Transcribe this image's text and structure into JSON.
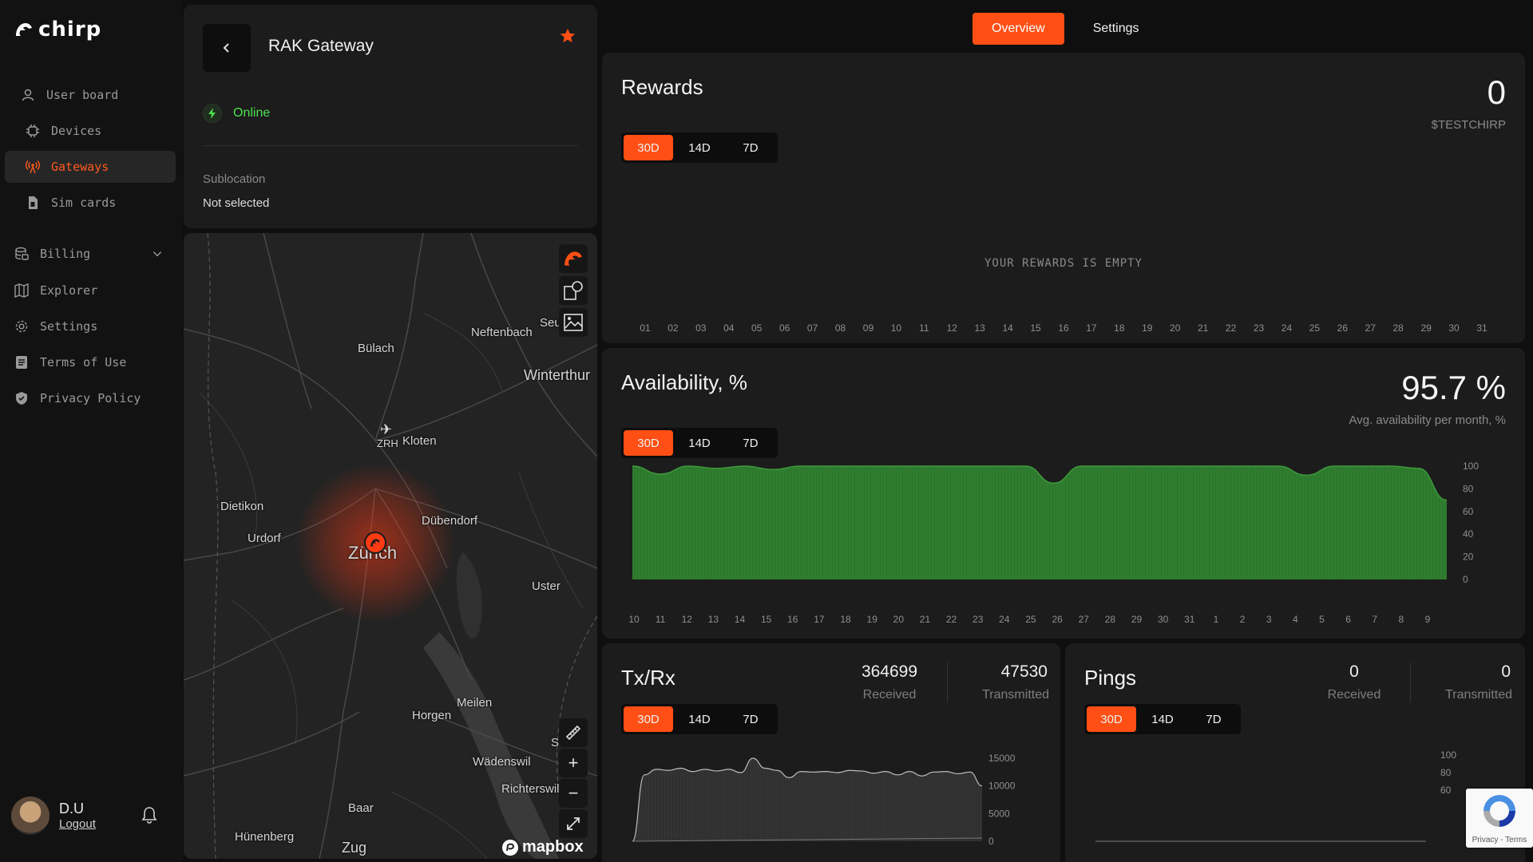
{
  "app": {
    "logo_text": "chirp"
  },
  "sidebar": {
    "items": [
      {
        "label": "User board",
        "icon": "user-icon",
        "active": false
      },
      {
        "label": "Devices",
        "icon": "chip-icon",
        "active": false
      },
      {
        "label": "Gateways",
        "icon": "antenna-icon",
        "active": true
      },
      {
        "label": "Sim cards",
        "icon": "simcard-icon",
        "active": false
      },
      {
        "label": "Billing",
        "icon": "billing-icon",
        "active": false
      },
      {
        "label": "Explorer",
        "icon": "map-icon",
        "active": false
      },
      {
        "label": "Settings",
        "icon": "gear-icon",
        "active": false
      },
      {
        "label": "Terms of Use",
        "icon": "document-icon",
        "active": false
      },
      {
        "label": "Privacy Policy",
        "icon": "shield-icon",
        "active": false
      }
    ],
    "user": {
      "name": "D.U",
      "logout_label": "Logout"
    }
  },
  "gateway": {
    "name": "RAK Gateway",
    "status": "Online",
    "sublocation_label": "Sublocation",
    "sublocation_value": "Not selected"
  },
  "map": {
    "labels": [
      "Neftenbach",
      "Bülach",
      "Winterthur",
      "ZRH",
      "Kloten",
      "Dietikon",
      "Urdorf",
      "Zürich",
      "Dübendorf",
      "Uster",
      "Meilen",
      "Horgen",
      "Wädenswil",
      "Richterswil",
      "Baar",
      "Hünenberg",
      "Zug",
      "Seu",
      "S..."
    ],
    "attribution": "mapbox"
  },
  "tabs": [
    {
      "label": "Overview",
      "active": true
    },
    {
      "label": "Settings",
      "active": false
    }
  ],
  "ranges": [
    "30D",
    "14D",
    "7D"
  ],
  "colors": {
    "accent": "#ff4f14",
    "online": "#4ee14e",
    "availability_fill": "#2f7d2f"
  },
  "rewards": {
    "title": "Rewards",
    "value": "0",
    "unit": "$TESTCHIRP",
    "empty_message": "YOUR REWARDS IS EMPTY",
    "x_ticks": [
      "01",
      "02",
      "03",
      "04",
      "05",
      "06",
      "07",
      "08",
      "09",
      "10",
      "11",
      "12",
      "13",
      "14",
      "15",
      "16",
      "17",
      "18",
      "19",
      "20",
      "21",
      "22",
      "23",
      "24",
      "25",
      "26",
      "27",
      "28",
      "29",
      "30",
      "31"
    ]
  },
  "availability": {
    "title": "Availability, %",
    "value": "95.7 %",
    "subtitle": "Avg. availability per month, %"
  },
  "txrx": {
    "title": "Tx/Rx",
    "received_value": "364699",
    "received_label": "Received",
    "transmitted_value": "47530",
    "transmitted_label": "Transmitted"
  },
  "pings": {
    "title": "Pings",
    "received_value": "0",
    "received_label": "Received",
    "transmitted_value": "0",
    "transmitted_label": "Transmitted"
  },
  "recaptcha": {
    "links": "Privacy - Terms"
  },
  "chart_data": [
    {
      "type": "area",
      "x": [
        "10",
        "11",
        "12",
        "13",
        "14",
        "15",
        "16",
        "17",
        "18",
        "19",
        "20",
        "21",
        "22",
        "23",
        "24",
        "25",
        "26",
        "27",
        "28",
        "29",
        "30",
        "31",
        "1",
        "2",
        "3",
        "4",
        "5",
        "6",
        "7",
        "8",
        "9"
      ],
      "values": [
        100,
        93,
        100,
        98,
        100,
        97,
        100,
        100,
        100,
        100,
        100,
        100,
        100,
        100,
        100,
        85,
        100,
        100,
        100,
        100,
        100,
        100,
        100,
        100,
        92,
        100,
        100,
        100,
        98,
        70
      ],
      "ylim": [
        0,
        100
      ],
      "y_ticks": [
        "100",
        "80",
        "60",
        "40",
        "20",
        "0"
      ],
      "grid": false
    },
    {
      "type": "area",
      "values": [
        0,
        12000,
        13000,
        12800,
        13200,
        12600,
        13000,
        12700,
        13000,
        12400,
        15000,
        13200,
        12800,
        11500,
        12600,
        12500,
        12600,
        12400,
        12800,
        12700,
        12300,
        12600,
        12000,
        12600,
        11800,
        12500,
        12600,
        12200,
        12500,
        10000
      ],
      "ylim": [
        0,
        15000
      ],
      "y_ticks": [
        "15000",
        "10000",
        "5000",
        "0"
      ],
      "grid": false
    },
    {
      "type": "line",
      "values": [
        0,
        0,
        0,
        0,
        0,
        0,
        0,
        0,
        0,
        0,
        0,
        0,
        0,
        0,
        0,
        0,
        0,
        0,
        0,
        0,
        0,
        0,
        0,
        0,
        0,
        0,
        0,
        0,
        0,
        0
      ],
      "ylim": [
        0,
        100
      ],
      "y_ticks": [
        "100",
        "80",
        "60"
      ],
      "grid": false
    }
  ]
}
